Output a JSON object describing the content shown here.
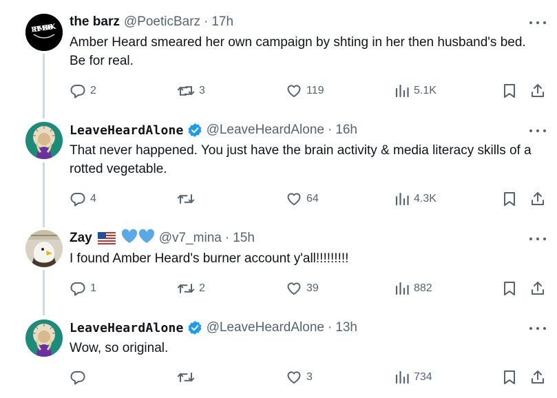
{
  "tweets": [
    {
      "name": "the barz",
      "handle": "@PoeticBarz",
      "time": "17h",
      "avatar_text": "RHYME BOOK",
      "text": "Amber Heard smeared her own campaign by shting in her then husband's bed. Be for real.",
      "replies": "2",
      "retweets": "3",
      "likes": "119",
      "views": "5.1K"
    },
    {
      "name": "LeaveHeardAlone",
      "handle": "@LeaveHeardAlone",
      "time": "16h",
      "verified": true,
      "text": "That never happened. You just have the brain activity & media literacy skills of a rotted vegetable.",
      "replies": "4",
      "retweets": "",
      "likes": "64",
      "views": "4.3K"
    },
    {
      "name": "Zay",
      "handle": "@v7_mina",
      "time": "15h",
      "flag": "us-flag",
      "hearts": [
        "blue-heart",
        "blue-heart"
      ],
      "text": "I found Amber Heard's burner account y'all!!!!!!!!!",
      "replies": "1",
      "retweets": "2",
      "likes": "39",
      "views": "882"
    },
    {
      "name": "LeaveHeardAlone",
      "handle": "@LeaveHeardAlone",
      "time": "13h",
      "verified": true,
      "text": "Wow, so original.",
      "replies": "",
      "retweets": "",
      "likes": "3",
      "views": "734"
    }
  ],
  "separator": "·",
  "colors": {
    "text": "#0f1419",
    "secondary": "#536471",
    "verified": "#1d9bf0",
    "thread_line": "#cfd9de",
    "heart_blue": "#5aa9e6"
  }
}
